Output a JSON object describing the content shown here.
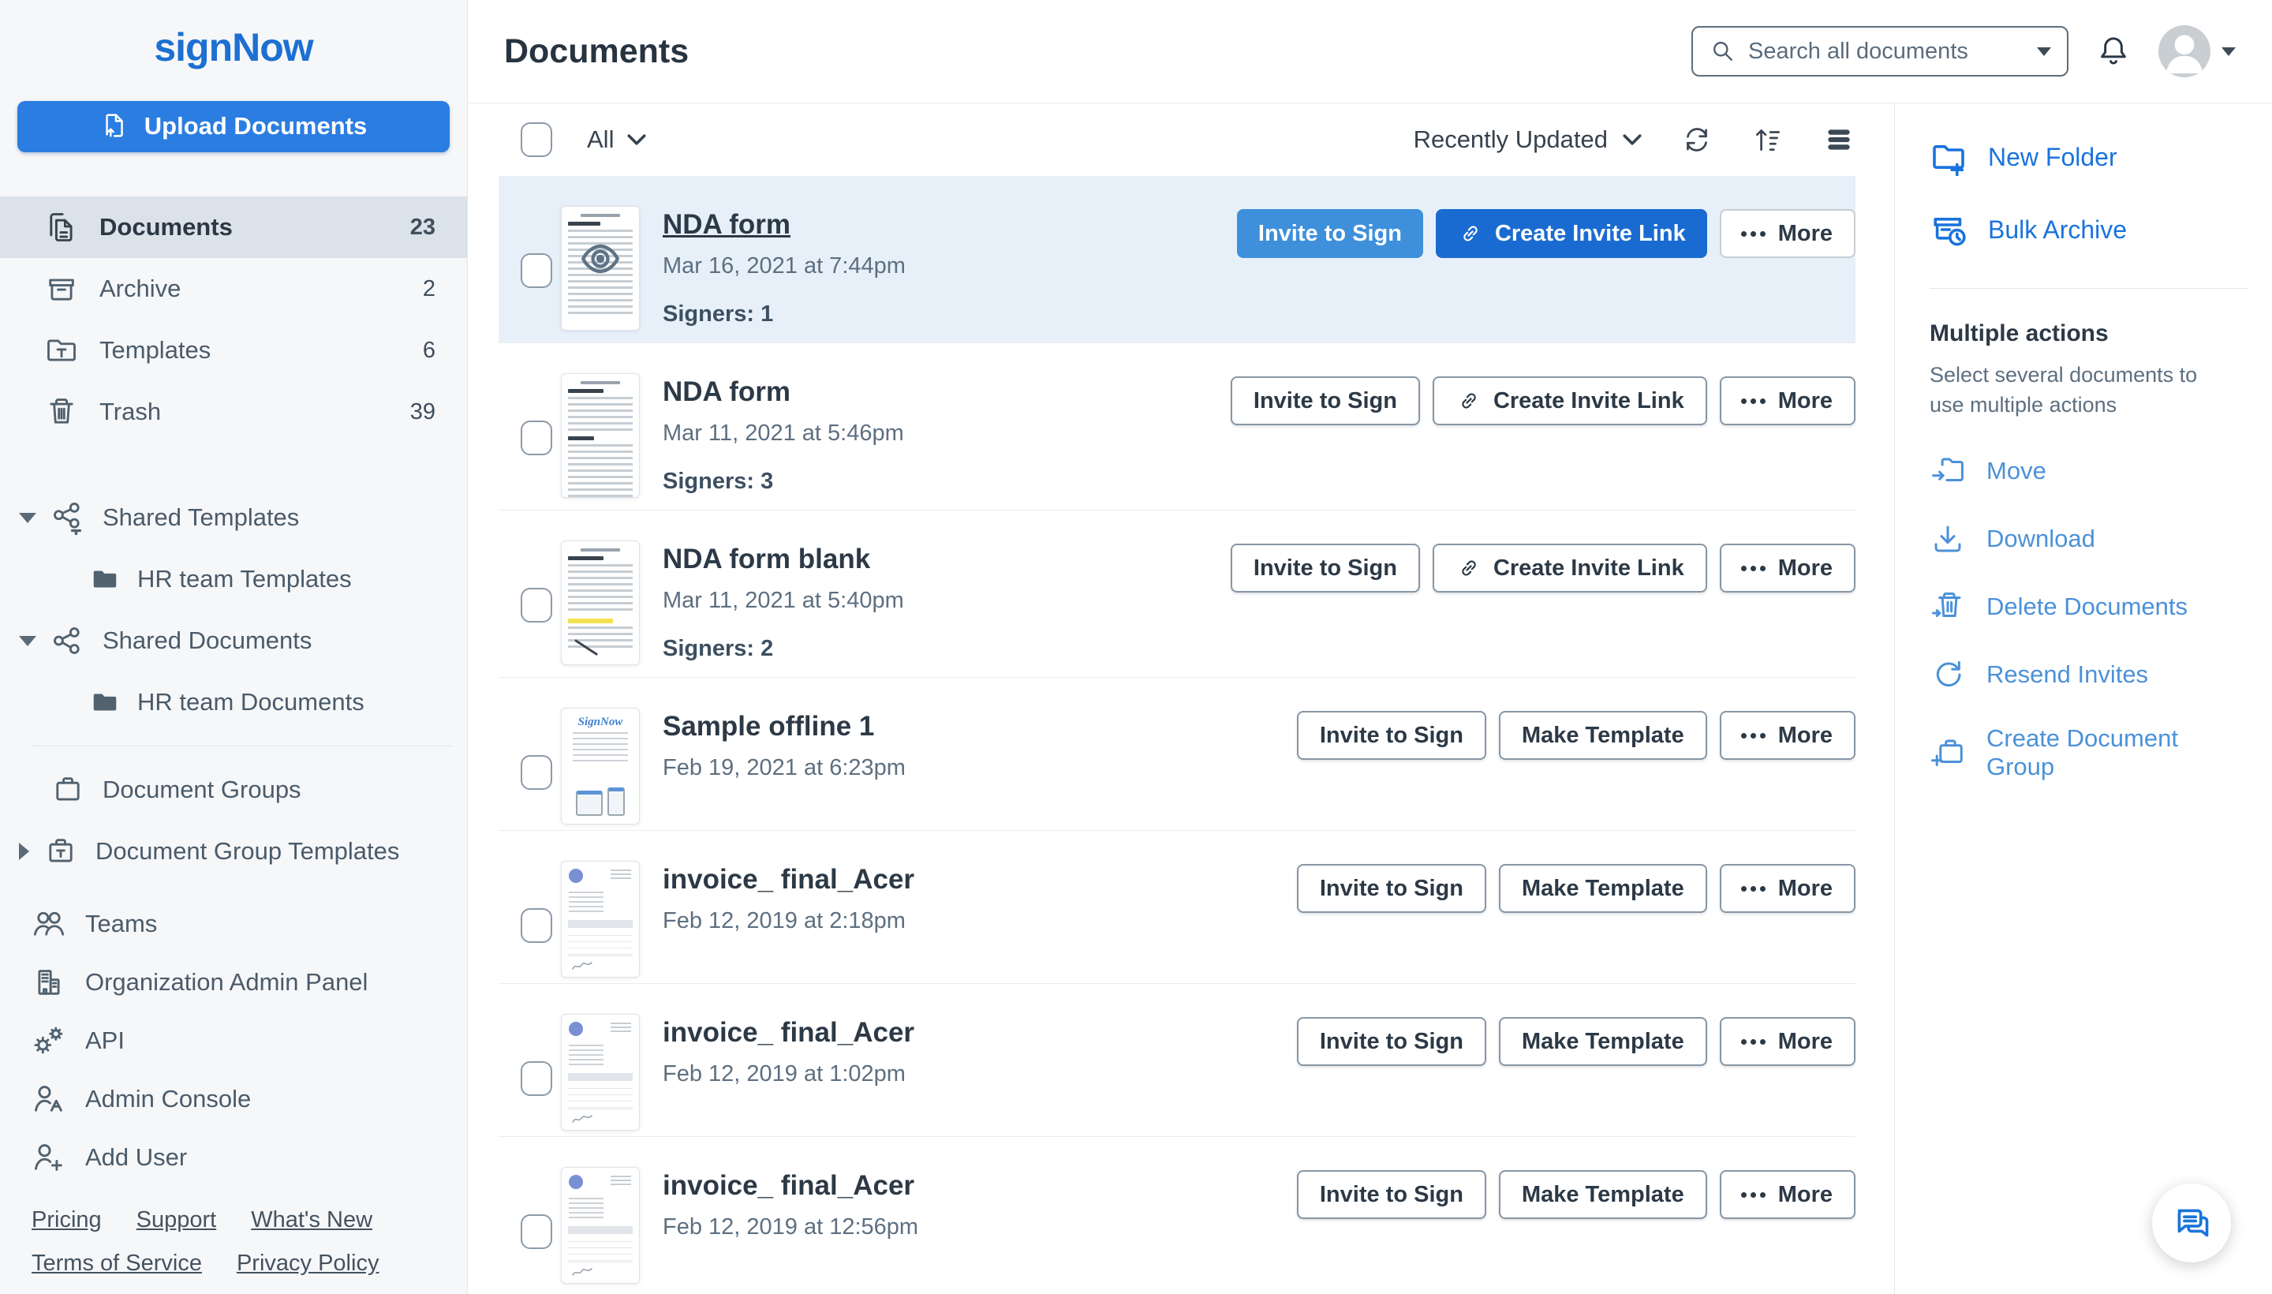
{
  "colors": {
    "brand_blue": "#1d70d2",
    "upload_button_blue": "#2b7de2",
    "invite_button_blue": "#3e90db",
    "create_link_button_blue": "#1a6bd1",
    "panel_link_blue": "#1a73dc",
    "panel_action_blue": "#4b91d8",
    "selected_row_bg": "#e7f0f9",
    "sidebar_bg": "#f6f7f9",
    "active_item_bg": "#dce2e9"
  },
  "sidebar": {
    "logo": "signNow",
    "upload_button": "Upload Documents",
    "upload_icon": "document-upload-icon",
    "items": [
      {
        "label": "Documents",
        "count": "23",
        "icon": "documents-icon",
        "active": true
      },
      {
        "label": "Archive",
        "count": "2",
        "icon": "archive-box-icon",
        "active": false
      },
      {
        "label": "Templates",
        "count": "6",
        "icon": "template-folder-icon",
        "active": false
      },
      {
        "label": "Trash",
        "count": "39",
        "icon": "trash-icon",
        "active": false
      }
    ],
    "tree": [
      {
        "label": "Shared Templates",
        "icon": "share-nodes-template-icon",
        "expanded": true
      },
      {
        "label": "HR team Templates",
        "icon": "folder-filled-icon",
        "child": true
      },
      {
        "label": "Shared Documents",
        "icon": "share-nodes-icon",
        "expanded": true
      },
      {
        "label": "HR team Documents",
        "icon": "folder-filled-icon",
        "child": true
      }
    ],
    "groups": [
      {
        "label": "Document Groups",
        "icon": "document-groups-case-icon"
      },
      {
        "label": "Document Group Templates",
        "icon": "document-group-templates-case-icon",
        "collapsed": true
      }
    ],
    "admin": [
      {
        "label": "Teams",
        "icon": "teams-icon"
      },
      {
        "label": "Organization Admin Panel",
        "icon": "organization-building-icon"
      },
      {
        "label": "API",
        "icon": "api-gears-icon"
      },
      {
        "label": "Admin Console",
        "icon": "admin-console-person-icon"
      },
      {
        "label": "Add User",
        "icon": "add-user-icon"
      }
    ],
    "footer_links_row1": [
      "Pricing",
      "Support",
      "What's New"
    ],
    "footer_links_row2": [
      "Terms of Service",
      "Privacy Policy"
    ]
  },
  "header": {
    "title": "Documents",
    "search_placeholder": "Search all documents",
    "bell_icon": "notification-bell-icon",
    "avatar_icon": "user-avatar-icon"
  },
  "toolbar": {
    "select_filter": "All",
    "sort_by": "Recently Updated",
    "icons": [
      "refresh-icon",
      "sort-order-icon",
      "list-view-icon"
    ]
  },
  "actions": {
    "invite_to_sign": "Invite to Sign",
    "create_invite_link": "Create Invite Link",
    "make_template": "Make Template",
    "more": "More"
  },
  "main": {
    "rows": [
      {
        "title": "NDA form",
        "date": "Mar 16, 2021 at 7:44pm",
        "signers": "Signers: 1",
        "selected": true,
        "thumbnail": "nda-text-with-eye-preview",
        "buttons": [
          "Invite to Sign",
          "Create Invite Link",
          "More"
        ]
      },
      {
        "title": "NDA form",
        "date": "Mar 11, 2021 at 5:46pm",
        "signers": "Signers: 3",
        "selected": false,
        "thumbnail": "nda-dense-text",
        "buttons": [
          "Invite to Sign",
          "Create Invite Link",
          "More"
        ]
      },
      {
        "title": "NDA form blank",
        "date": "Mar 11, 2021 at 5:40pm",
        "signers": "Signers: 2",
        "selected": false,
        "thumbnail": "nda-text-highlighted-signed",
        "buttons": [
          "Invite to Sign",
          "Create Invite Link",
          "More"
        ]
      },
      {
        "title": "Sample offline 1",
        "date": "Feb 19, 2021 at 6:23pm",
        "selected": false,
        "thumbnail": "signnow-sample-devices",
        "buttons": [
          "Invite to Sign",
          "Make Template",
          "More"
        ]
      },
      {
        "title": "invoice_ final_Acer",
        "date": "Feb 12, 2019 at 2:18pm",
        "selected": false,
        "thumbnail": "invoice-document",
        "buttons": [
          "Invite to Sign",
          "Make Template",
          "More"
        ]
      },
      {
        "title": "invoice_ final_Acer",
        "date": "Feb 12, 2019 at 1:02pm",
        "selected": false,
        "thumbnail": "invoice-document",
        "buttons": [
          "Invite to Sign",
          "Make Template",
          "More"
        ]
      },
      {
        "title": "invoice_ final_Acer",
        "date": "Feb 12, 2019 at 12:56pm",
        "selected": false,
        "thumbnail": "invoice-document",
        "buttons": [
          "Invite to Sign",
          "Make Template",
          "More"
        ]
      }
    ]
  },
  "right_panel": {
    "new_folder": "New Folder",
    "bulk_archive": "Bulk Archive",
    "multiple_actions_title": "Multiple actions",
    "multiple_actions_hint": "Select several documents to use multiple actions",
    "actions": [
      {
        "label": "Move",
        "icon": "move-folder-icon"
      },
      {
        "label": "Download",
        "icon": "download-icon"
      },
      {
        "label": "Delete Documents",
        "icon": "delete-trash-icon"
      },
      {
        "label": "Resend Invites",
        "icon": "resend-circular-arrow-icon"
      },
      {
        "label": "Create Document Group",
        "icon": "create-group-case-icon"
      }
    ],
    "chat_icon": "chat-bubbles-icon"
  }
}
